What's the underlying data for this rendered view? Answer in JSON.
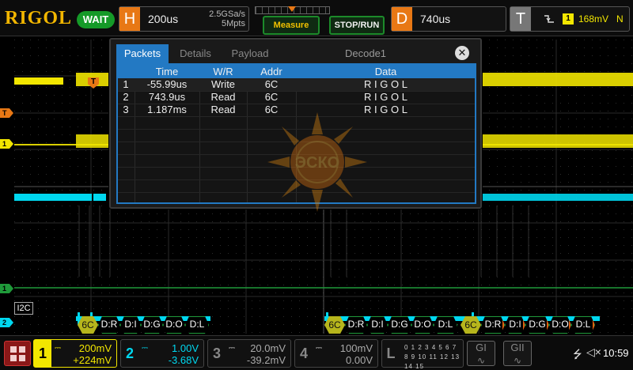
{
  "brand": {
    "logo": "RIGOL",
    "run_state": "WAIT"
  },
  "horizontal": {
    "letter": "H",
    "timebase": "200us",
    "sample_rate": "2.5GSa/s",
    "memory_depth": "5Mpts"
  },
  "buttons": {
    "measure": "Measure",
    "stop_run": "STOP/RUN"
  },
  "delay": {
    "letter": "D",
    "value": "740us"
  },
  "trigger": {
    "letter": "T",
    "type_icon": "falling-edge-icon",
    "source": "1",
    "level": "168mV",
    "mode": "N",
    "level_marker": "T"
  },
  "colors": {
    "ch1": "#f2e600",
    "ch2": "#00d8f0",
    "decode": "#1f9a3a",
    "addr_fill": "#b6b51c",
    "accent": "#2379c3",
    "orange": "#e87815"
  },
  "markers": {
    "trig_level": "T",
    "ch1": "1",
    "ch2": "2",
    "bus": "1",
    "ch2_bottom": "2"
  },
  "bus_label": "I2C",
  "decode_row": {
    "frames": [
      [
        "6C",
        "D:R",
        "D:I",
        "D:G",
        "D:O",
        "D:L"
      ],
      [
        "6C",
        "D:R",
        "D:I",
        "D:G",
        "D:O",
        "D:L"
      ],
      [
        "6C",
        "D:R",
        "D:I",
        "D:G",
        "D:O",
        "D:L"
      ]
    ]
  },
  "panel": {
    "tabs": [
      "Packets",
      "Details",
      "Payload"
    ],
    "title": "Decode1",
    "close_glyph": "✕",
    "columns": [
      "",
      "Time",
      "W/R",
      "Addr",
      "Data"
    ],
    "rows": [
      [
        "1",
        "-55.99us",
        "Write",
        "6C",
        "R I G O L"
      ],
      [
        "2",
        "743.9us",
        "Read",
        "6C",
        "R I G O L"
      ],
      [
        "3",
        "1.187ms",
        "Read",
        "6C",
        "R I G O L"
      ]
    ],
    "watermark_text": "ЭСКО"
  },
  "bottom": {
    "menu_icon": "grid-menu-icon",
    "ch1": {
      "num": "1",
      "scale": "200mV",
      "offset": "+224mV"
    },
    "ch2": {
      "num": "2",
      "scale": "1.00V",
      "offset": "-3.68V"
    },
    "ch3": {
      "num": "3",
      "scale": "20.0mV",
      "offset": "-39.2mV"
    },
    "ch4": {
      "num": "4",
      "scale": "100mV",
      "offset": "0.00V"
    },
    "la": {
      "letter": "L",
      "row1": "0 1 2 3 4 5 6 7",
      "row2": "8 9 10 11 12 13 14 15"
    },
    "gen1": "GI",
    "gen2": "GII",
    "time": "10:59"
  }
}
